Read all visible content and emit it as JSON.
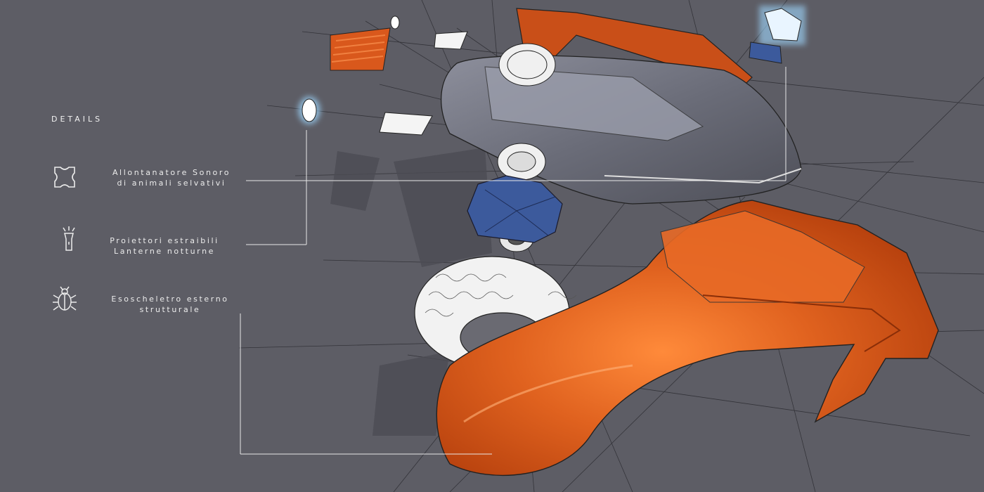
{
  "panel": {
    "title": "DETAILS",
    "items": [
      {
        "icon": "cross-shape-icon",
        "line1": "Allontanatore Sonoro",
        "line2": "di animali selvativi"
      },
      {
        "icon": "flashlight-icon",
        "line1": "Proiettori estraibili",
        "line2": "Lanterne notturne"
      },
      {
        "icon": "beetle-icon",
        "line1": "Esoscheletro esterno",
        "line2": "strutturale"
      }
    ]
  },
  "colors": {
    "background": "#5d5d65",
    "accent_orange": "#d9581c",
    "accent_blue": "#3c5a9c",
    "text": "#ececec"
  }
}
